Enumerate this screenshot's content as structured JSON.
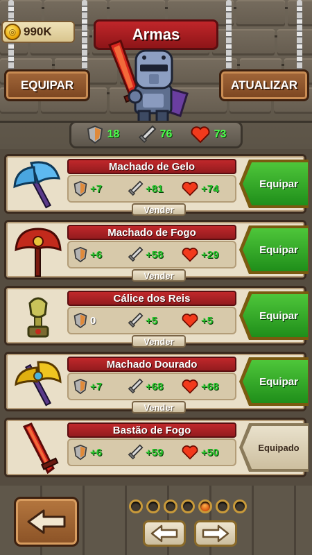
{
  "header": {
    "coins": "990K",
    "title": "Armas",
    "equip_label": "EQUIPAR",
    "upgrade_label": "ATUALIZAR"
  },
  "totals": {
    "defense": "18",
    "attack": "76",
    "health": "73"
  },
  "items": [
    {
      "name": "Machado de Gelo",
      "defense": "+7",
      "attack": "+81",
      "health": "+74",
      "sell": "Vender",
      "action": "Equipar"
    },
    {
      "name": "Machado de Fogo",
      "defense": "+6",
      "attack": "+58",
      "health": "+29",
      "sell": "Vender",
      "action": "Equipar"
    },
    {
      "name": "Cálice dos Reis",
      "defense": "0",
      "attack": "+5",
      "health": "+5",
      "sell": "Vender",
      "action": "Equipar"
    },
    {
      "name": "Machado Dourado",
      "defense": "+7",
      "attack": "+68",
      "health": "+68",
      "sell": "Vender",
      "action": "Equipar"
    },
    {
      "name": "Bastão de Fogo",
      "defense": "+6",
      "attack": "+59",
      "health": "+50",
      "action": "Equipado"
    }
  ],
  "pagination": {
    "total_pages": 7,
    "current_page": 5
  },
  "icons": {
    "coin": "coin-icon",
    "defense": "shield-icon",
    "attack": "sword-icon",
    "health": "heart-icon",
    "back": "back-arrow-icon",
    "prev": "left-arrow-icon",
    "next": "right-arrow-icon"
  },
  "colors": {
    "stat_green": "#25c52a",
    "equip_green": "#2fa826",
    "banner_red": "#b3242a"
  }
}
